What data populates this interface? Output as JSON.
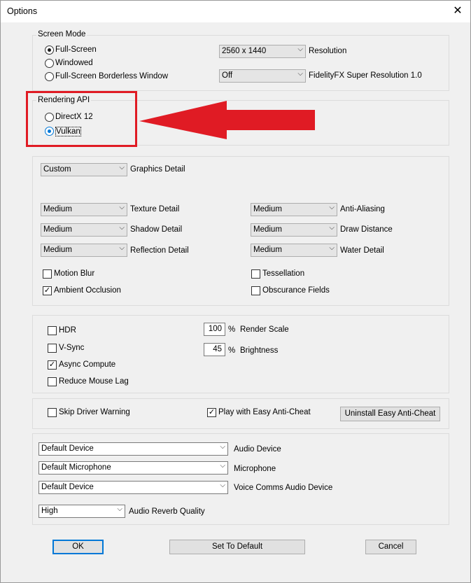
{
  "window": {
    "title": "Options",
    "close": "✕"
  },
  "screen_mode": {
    "label": "Screen Mode",
    "options": [
      "Full-Screen",
      "Windowed",
      "Full-Screen Borderless Window"
    ],
    "selected": "Full-Screen",
    "resolution": {
      "value": "2560 x 1440",
      "label": "Resolution"
    },
    "fsr": {
      "value": "Off",
      "label": "FidelityFX Super Resolution 1.0"
    }
  },
  "rendering_api": {
    "label": "Rendering API",
    "options": [
      "DirectX 12",
      "Vulkan"
    ],
    "selected": "Vulkan"
  },
  "graphics": {
    "detail": {
      "value": "Custom",
      "label": "Graphics Detail"
    },
    "left": [
      {
        "value": "Medium",
        "label": "Texture Detail"
      },
      {
        "value": "Medium",
        "label": "Shadow Detail"
      },
      {
        "value": "Medium",
        "label": "Reflection Detail"
      }
    ],
    "right": [
      {
        "value": "Medium",
        "label": "Anti-Aliasing"
      },
      {
        "value": "Medium",
        "label": "Draw Distance"
      },
      {
        "value": "Medium",
        "label": "Water Detail"
      }
    ],
    "checks": [
      {
        "label": "Motion Blur",
        "checked": false
      },
      {
        "label": "Ambient Occlusion",
        "checked": true
      },
      {
        "label": "Tessellation",
        "checked": false
      },
      {
        "label": "Obscurance Fields",
        "checked": false
      }
    ]
  },
  "display": {
    "checks": [
      {
        "label": "HDR",
        "checked": false
      },
      {
        "label": "V-Sync",
        "checked": false
      },
      {
        "label": "Async Compute",
        "checked": true
      },
      {
        "label": "Reduce Mouse Lag",
        "checked": false
      }
    ],
    "render_scale": {
      "value": "100",
      "unit": "%",
      "label": "Render Scale"
    },
    "brightness": {
      "value": "45",
      "unit": "%",
      "label": "Brightness"
    }
  },
  "anticheat": {
    "skip_driver": {
      "label": "Skip Driver Warning",
      "checked": false
    },
    "easy_ac": {
      "label": "Play with Easy Anti-Cheat",
      "checked": true
    },
    "uninstall": "Uninstall Easy Anti-Cheat"
  },
  "audio": {
    "rows": [
      {
        "value": "Default Device",
        "label": "Audio Device"
      },
      {
        "value": "Default Microphone",
        "label": "Microphone"
      },
      {
        "value": "Default Device",
        "label": "Voice Comms Audio Device"
      }
    ],
    "reverb": {
      "value": "High",
      "label": "Audio Reverb Quality"
    }
  },
  "buttons": {
    "ok": "OK",
    "default": "Set To Default",
    "cancel": "Cancel"
  },
  "icons": {
    "check": "✓",
    "dropdown": "⌵"
  },
  "colors": {
    "highlight": "#e01b24",
    "accent": "#0078d7"
  }
}
